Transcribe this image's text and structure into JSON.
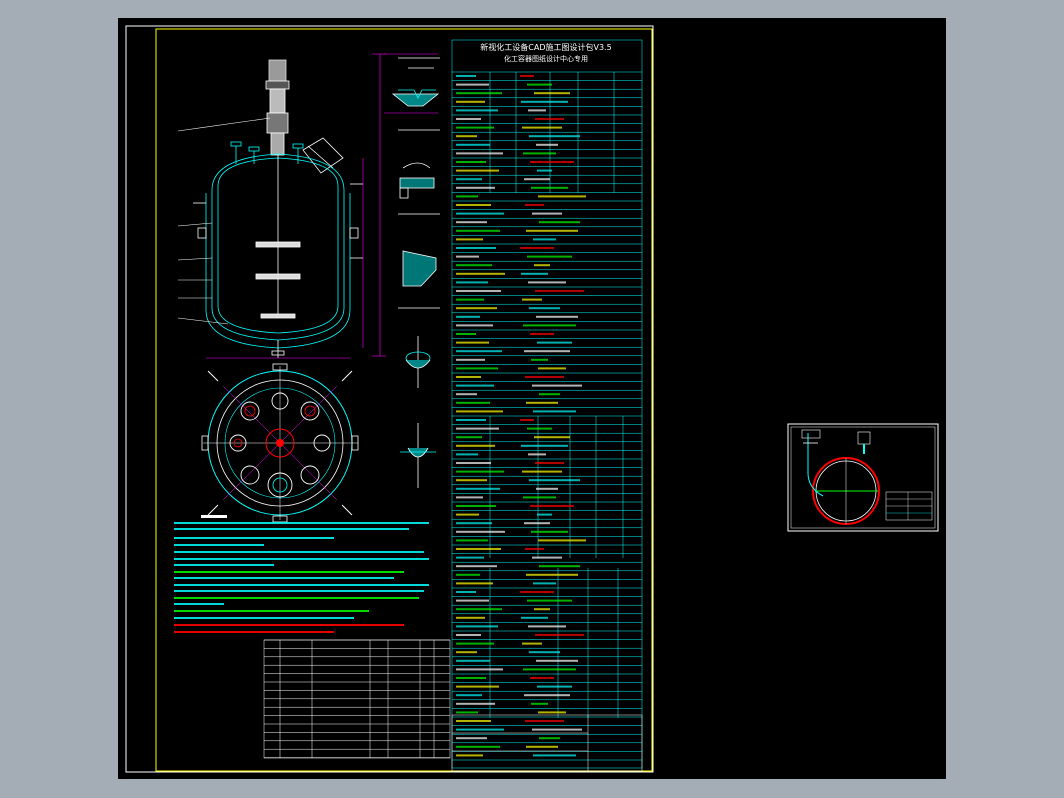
{
  "drawing": {
    "title_line1": "新视化工设备CAD施工图设计包V3.5",
    "title_line2": "化工容器图纸设计中心专用"
  },
  "colors": {
    "background": "#a4adb6",
    "canvas": "#000000",
    "frame": "#ffff00",
    "table": "#00ffff",
    "dim": "#ff00ff",
    "vessel": "#00ffff",
    "notes": "#00ffff",
    "green": "#00ff00",
    "red": "#ff0000",
    "white": "#ffffff"
  }
}
